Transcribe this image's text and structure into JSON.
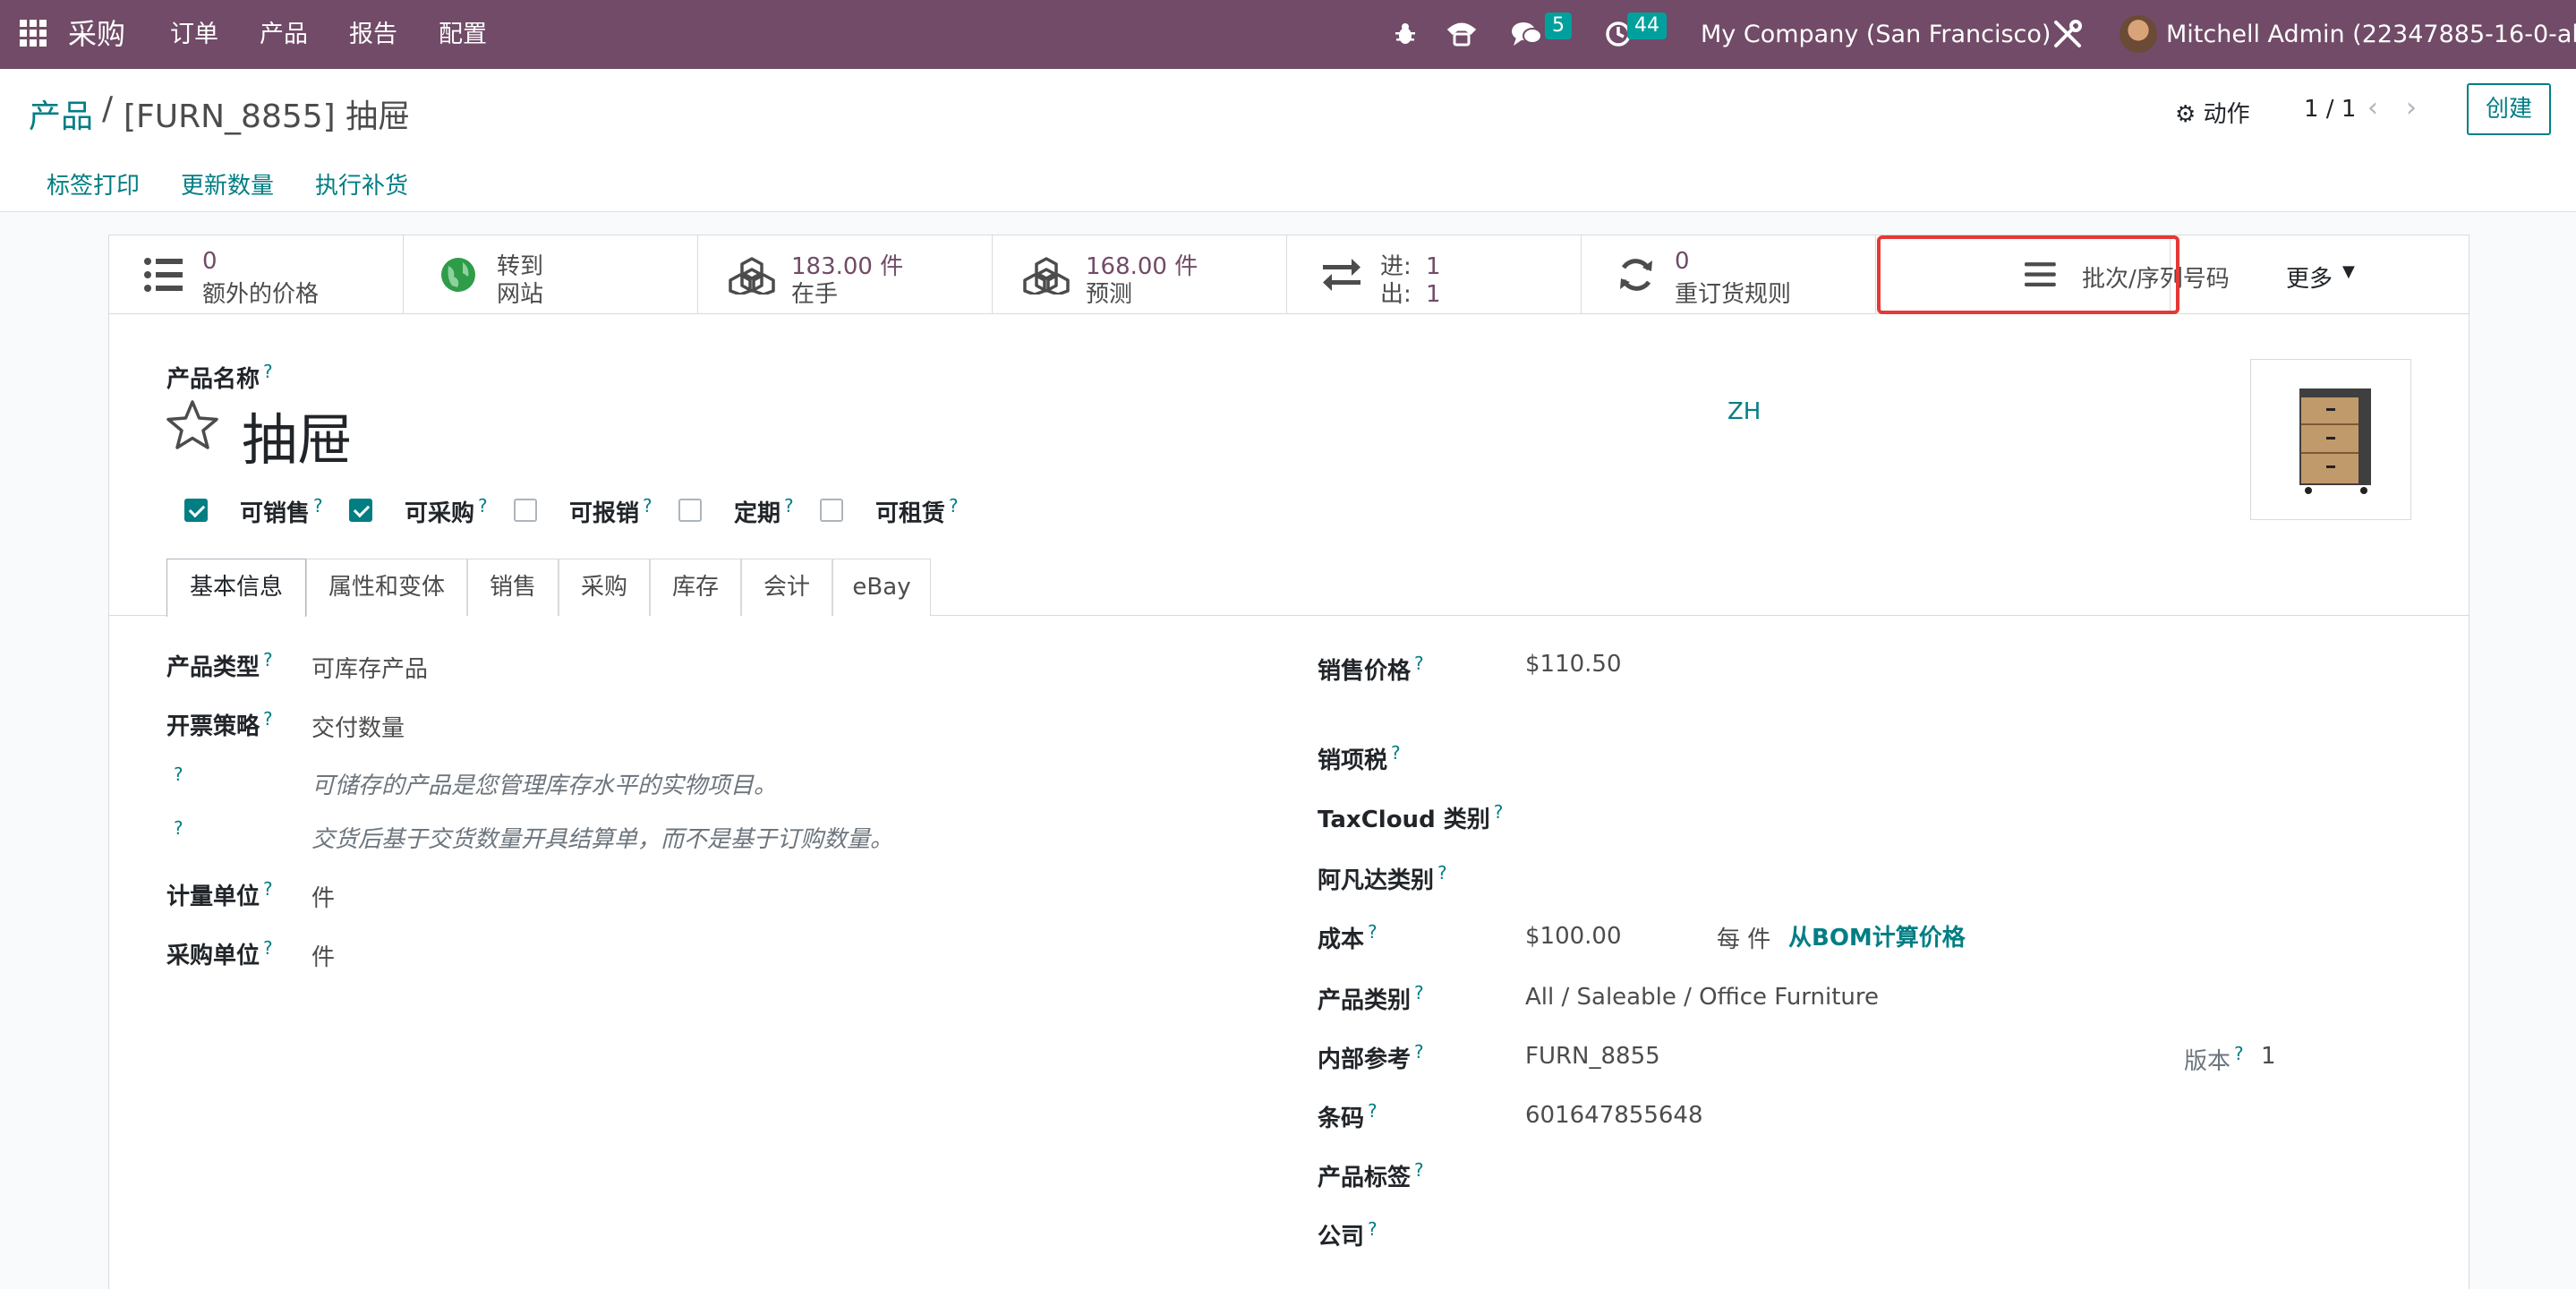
{
  "topbar": {
    "app_name": "采购",
    "menu": [
      "订单",
      "产品",
      "报告",
      "配置"
    ],
    "messages_count": "5",
    "activities_count": "44",
    "company": "My Company (San Francisco)",
    "user": "Mitchell Admin (22347885-16-0-all)"
  },
  "control": {
    "breadcrumb_parent": "产品",
    "breadcrumb_sep": "/",
    "breadcrumb_current": "[FURN_8855] 抽屉",
    "action_label": "动作",
    "pager": "1 / 1",
    "create_label": "创建",
    "buttons": [
      "标签打印",
      "更新数量",
      "执行补货"
    ]
  },
  "stats": [
    {
      "value": "0",
      "label": "额外的价格"
    },
    {
      "value": "转到",
      "label": "网站"
    },
    {
      "value": "183.00 件",
      "label": "在手"
    },
    {
      "value": "168.00 件",
      "label": "预测"
    },
    {
      "in_label": "进:",
      "in_value": "1",
      "out_label": "出:",
      "out_value": "1"
    },
    {
      "value": "0",
      "label": "重订货规则"
    },
    {
      "label": "批次/序列号码"
    },
    {
      "label": "更多"
    }
  ],
  "form": {
    "name_label": "产品名称",
    "name": "抽屉",
    "lang": "ZH",
    "checkboxes": [
      {
        "label": "可销售",
        "checked": true
      },
      {
        "label": "可采购",
        "checked": true
      },
      {
        "label": "可报销",
        "checked": false
      },
      {
        "label": "定期",
        "checked": false
      },
      {
        "label": "可租赁",
        "checked": false
      }
    ],
    "tabs": [
      "基本信息",
      "属性和变体",
      "销售",
      "采购",
      "库存",
      "会计",
      "eBay"
    ],
    "left": {
      "product_type_label": "产品类型",
      "product_type": "可库存产品",
      "invoice_policy_label": "开票策略",
      "invoice_policy": "交付数量",
      "hint1": "可储存的产品是您管理库存水平的实物项目。",
      "hint2": "交货后基于交货数量开具结算单，而不是基于订购数量。",
      "uom_label": "计量单位",
      "uom": "件",
      "purchase_uom_label": "采购单位",
      "purchase_uom": "件"
    },
    "right": {
      "sale_price_label": "销售价格",
      "sale_price": "$110.50",
      "taxes_label": "销项税",
      "taxcloud_label": "TaxCloud 类别",
      "avatax_label": "阿凡达类别",
      "cost_label": "成本",
      "cost": "$100.00",
      "cost_unit": "每 件",
      "bom_link": "从BOM计算价格",
      "category_label": "产品类别",
      "category": "All / Saleable / Office Furniture",
      "ref_label": "内部参考",
      "ref": "FURN_8855",
      "version_label": "版本",
      "version": "1",
      "barcode_label": "条码",
      "barcode": "601647855648",
      "tags_label": "产品标签",
      "company_label": "公司"
    }
  },
  "colors": {
    "brand": "#714b67",
    "accent": "#017e84",
    "highlight": "#e53935"
  }
}
